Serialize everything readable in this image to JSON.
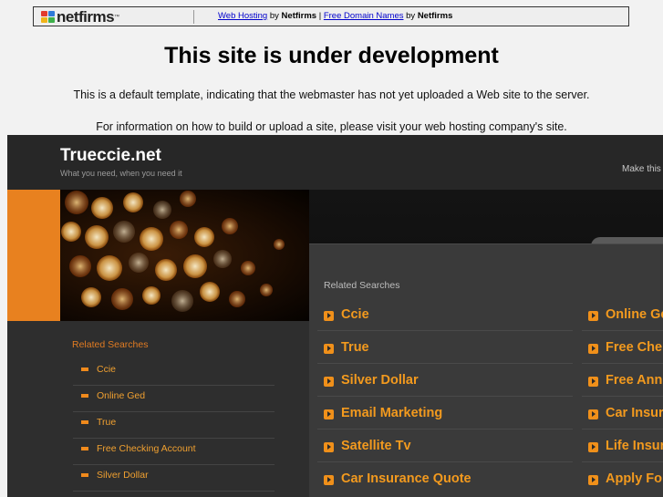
{
  "topbar": {
    "logo_text": "netfirms",
    "links": {
      "web_hosting": "Web Hosting",
      "by1": "by",
      "netfirms1": "Netfirms",
      "pipe": "|",
      "free_domains": "Free Domain Names",
      "by2": "by",
      "netfirms2": "Netfirms"
    }
  },
  "headline": "This site is under development",
  "note1": "This is a default template, indicating that the webmaster has not yet uploaded a Web site to the server.",
  "note2": "For information on how to build or upload a site, please visit your web hosting company's site.",
  "park": {
    "site_title": "Trueccie.net",
    "tagline": "What you need, when you need it",
    "make_this": "Make this",
    "left_heading": "Related Searches",
    "left_items": [
      "Ccie",
      "Online Ged",
      "True",
      "Free Checking Account",
      "Silver Dollar"
    ],
    "right_heading": "Related Searches",
    "right_col1": [
      "Ccie",
      "True",
      "Silver Dollar",
      "Email Marketing",
      "Satellite Tv",
      "Car Insurance Quote"
    ],
    "right_col2": [
      "Online Ge",
      "Free Che",
      "Free Ann",
      "Car Insur",
      "Life Insur",
      "Apply Fo"
    ]
  },
  "colors": {
    "accent_orange": "#f39a1e",
    "dark_bg": "#2a2a2a",
    "link_blue": "#0000cc"
  },
  "icons": [
    "netfirms-logo-icon",
    "search-icon",
    "arrow-bullet-icon"
  ]
}
